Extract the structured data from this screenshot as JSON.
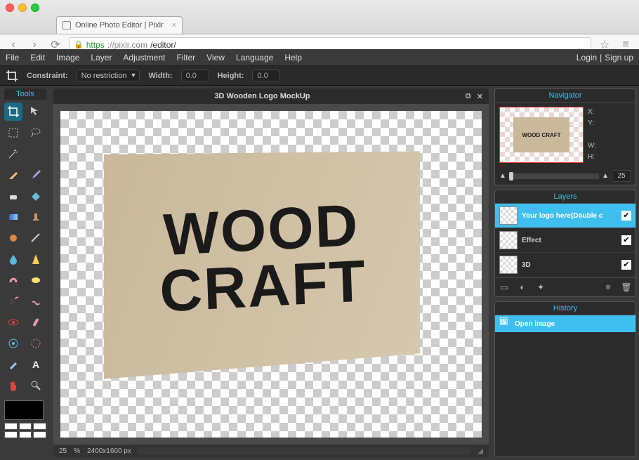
{
  "browser": {
    "tab_title": "Online Photo Editor | Pixlr",
    "url_scheme": "https",
    "url_domain": "://pixlr.com",
    "url_path": "/editor/"
  },
  "menubar": {
    "items": [
      "File",
      "Edit",
      "Image",
      "Layer",
      "Adjustment",
      "Filter",
      "View",
      "Language",
      "Help"
    ],
    "login": "Login",
    "signup": "Sign up"
  },
  "toolbar": {
    "constraint_label": "Constraint:",
    "constraint_value": "No restriction",
    "width_label": "Width:",
    "width_value": "0.0",
    "height_label": "Height:",
    "height_value": "0.0"
  },
  "tools_panel": {
    "title": "Tools",
    "tool_names": [
      "crop",
      "move",
      "marquee",
      "lasso",
      "wand",
      "",
      "pencil",
      "brush",
      "eraser",
      "paint-bucket",
      "gradient",
      "clone-stamp",
      "color-replace",
      "draw",
      "blur",
      "sharpen",
      "smudge",
      "sponge",
      "dodge",
      "burn",
      "red-eye",
      "spot-heal",
      "bloat",
      "pinch",
      "color-picker",
      "type",
      "hand",
      "zoom"
    ]
  },
  "canvas": {
    "title": "3D Wooden Logo MockUp",
    "wood_line1": "WOOD",
    "wood_line2": "CRAFT",
    "zoom_percent": "25",
    "zoom_percent_sym": "%",
    "dimensions": "2400x1600 px"
  },
  "navigator": {
    "title": "Navigator",
    "x_label": "X:",
    "y_label": "Y:",
    "w_label": "W:",
    "h_label": "H:",
    "zoom_value": "25",
    "thumb_text": "WOOD CRAFT"
  },
  "layers_panel": {
    "title": "Layers",
    "items": [
      {
        "name": "Your logo here(Double c",
        "checked": true,
        "selected": true
      },
      {
        "name": "Effect",
        "checked": true,
        "selected": false
      },
      {
        "name": "3D",
        "checked": true,
        "selected": false
      }
    ]
  },
  "history_panel": {
    "title": "History",
    "items": [
      {
        "name": "Open image",
        "selected": true
      }
    ]
  }
}
